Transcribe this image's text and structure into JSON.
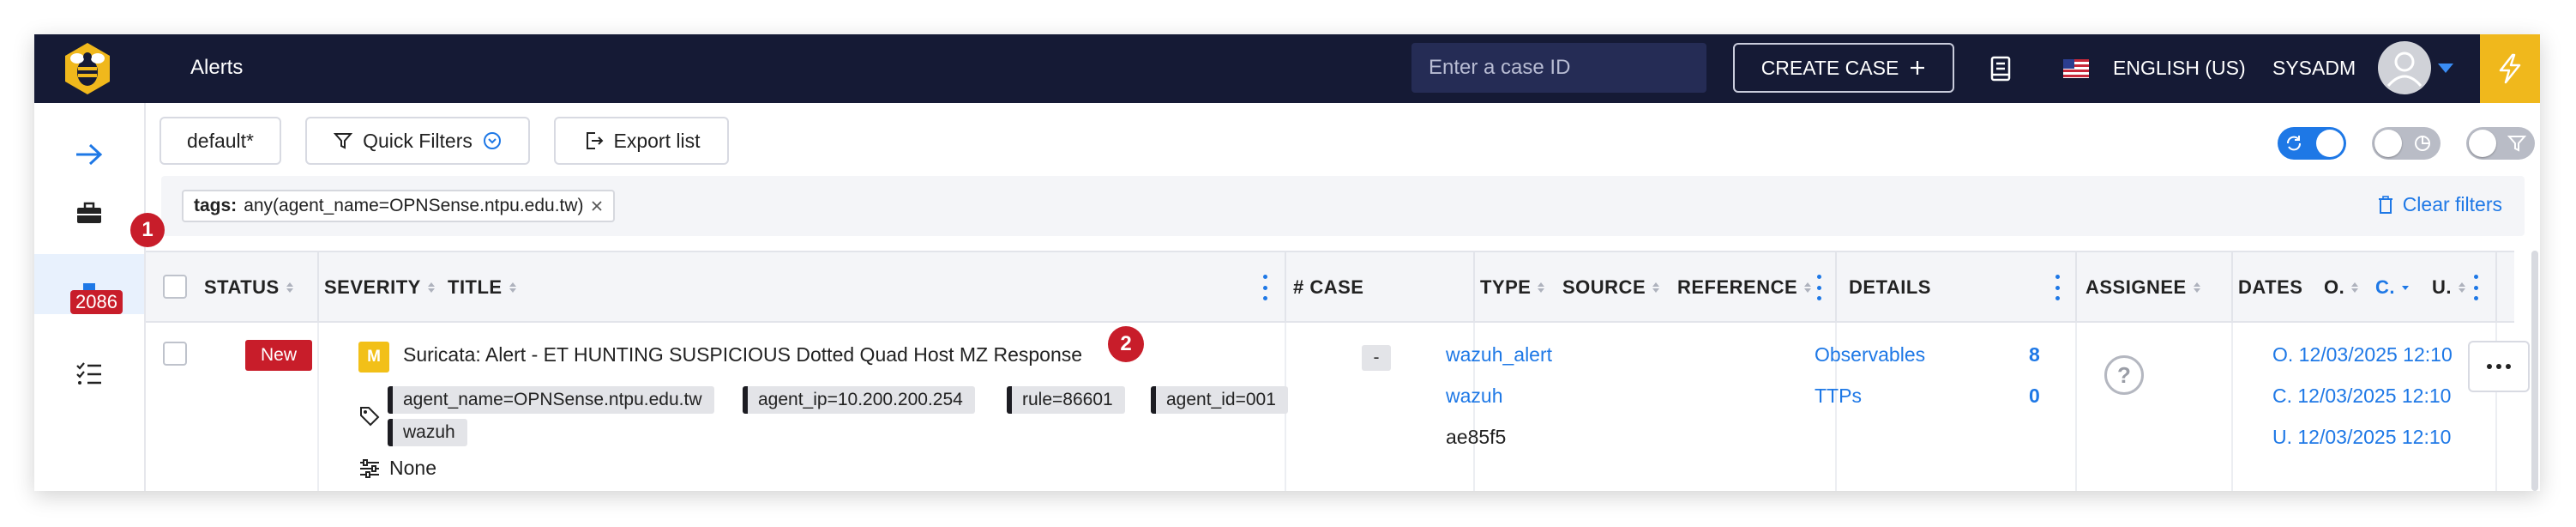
{
  "topbar": {
    "title": "Alerts",
    "case_search_placeholder": "Enter a case ID",
    "create_case_label": "CREATE CASE",
    "language": "ENGLISH (US)",
    "username": "SYSADM"
  },
  "sidebar": {
    "alerts_count": "2086",
    "step_marker": "1"
  },
  "toolbar": {
    "view_label": "default*",
    "quick_filters_label": "Quick Filters",
    "export_label": "Export list"
  },
  "filters": {
    "tag_key": "tags:",
    "tag_value": "any(agent_name=OPNSense.ntpu.edu.tw)",
    "clear_label": "Clear filters"
  },
  "table": {
    "headers": {
      "status": "STATUS",
      "severity": "SEVERITY",
      "title": "TITLE",
      "case": "# CASE",
      "type": "TYPE",
      "source": "SOURCE",
      "reference": "REFERENCE",
      "details": "DETAILS",
      "assignee": "ASSIGNEE",
      "dates": "DATES",
      "occurred": "O.",
      "created": "C.",
      "updated": "U."
    },
    "rows": [
      {
        "status": "New",
        "severity": "M",
        "title": "Suricata: Alert - ET HUNTING SUSPICIOUS Dotted Quad Host MZ Response",
        "step_marker": "2",
        "tags": [
          "agent_name=OPNSense.ntpu.edu.tw",
          "agent_ip=10.200.200.254",
          "rule=86601",
          "agent_id=001",
          "wazuh"
        ],
        "custom_fields": "None",
        "case": "-",
        "type": "wazuh_alert",
        "source": "wazuh",
        "reference": "ae85f5",
        "observables_label": "Observables",
        "observables_count": "8",
        "ttps_label": "TTPs",
        "ttps_count": "0",
        "assignee": "?",
        "date_occurred": "O. 12/03/2025 12:10",
        "date_created": "C. 12/03/2025 12:10",
        "date_updated": "U. 12/03/2025 12:10"
      }
    ]
  },
  "colors": {
    "topbar_bg": "#151a35",
    "accent_blue": "#1e78e6",
    "new_status_red": "#c81d2a",
    "severity_medium": "#f2c018",
    "bolt_yellow": "#f0b81c"
  },
  "icons": [
    "bee-logo-icon",
    "search-icon",
    "plus-icon",
    "book-icon",
    "us-flag-icon",
    "user-avatar-icon",
    "chevron-down-icon",
    "bolt-icon",
    "arrow-right-icon",
    "briefcase-icon",
    "alerts-icon",
    "tasks-icon",
    "funnel-icon",
    "chevron-circle-icon",
    "export-icon",
    "refresh-icon",
    "pie-chart-icon",
    "filter-icon",
    "close-icon",
    "trash-icon",
    "tag-icon",
    "sliders-icon",
    "question-icon",
    "more-icon"
  ]
}
